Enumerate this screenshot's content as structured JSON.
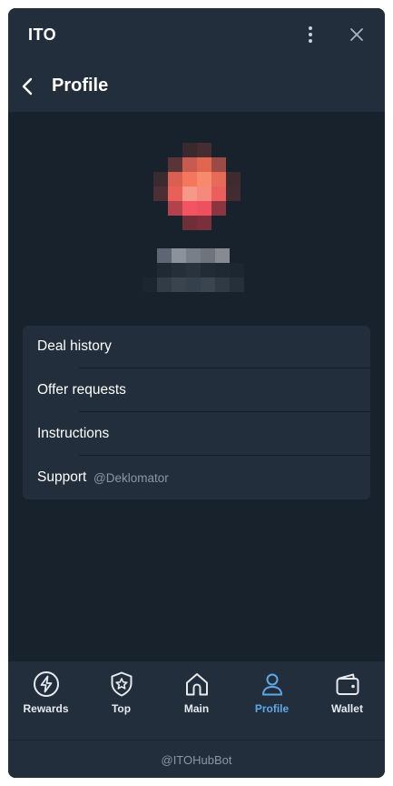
{
  "window": {
    "app_title": "ITO"
  },
  "header": {
    "title": "Profile"
  },
  "menu": {
    "items": [
      {
        "label": "Deal history",
        "sub": ""
      },
      {
        "label": "Offer requests",
        "sub": ""
      },
      {
        "label": "Instructions",
        "sub": ""
      },
      {
        "label": "Support",
        "sub": "@Deklomator"
      }
    ]
  },
  "tabs": [
    {
      "label": "Rewards",
      "icon": "lightning-icon",
      "active": false
    },
    {
      "label": "Top",
      "icon": "star-badge-icon",
      "active": false
    },
    {
      "label": "Main",
      "icon": "home-icon",
      "active": false
    },
    {
      "label": "Profile",
      "icon": "person-icon",
      "active": true
    },
    {
      "label": "Wallet",
      "icon": "wallet-icon",
      "active": false
    }
  ],
  "footer": {
    "bot_name": "@ITOHubBot"
  },
  "colors": {
    "background": "#18222d",
    "panel": "#232e3c",
    "accent": "#5ea8e8",
    "muted_text": "#8a97a5"
  }
}
